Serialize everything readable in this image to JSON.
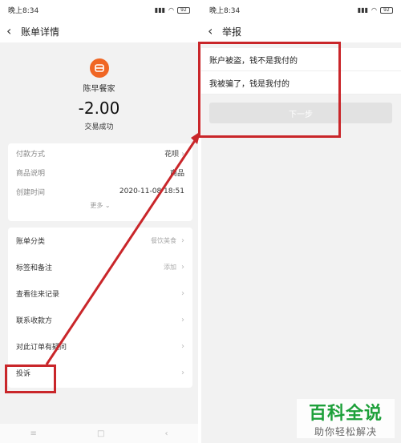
{
  "left": {
    "status": {
      "time": "晚上8:34",
      "battery": "92"
    },
    "nav_title": "账单详情",
    "merchant": {
      "name": "陈早餐家",
      "amount": "-2.00",
      "status": "交易成功"
    },
    "details": [
      {
        "key": "付款方式",
        "value": "花呗"
      },
      {
        "key": "商品说明",
        "value": "商品"
      },
      {
        "key": "创建时间",
        "value": "2020-11-08 18:51"
      }
    ],
    "more": "更多",
    "menu": [
      {
        "label": "账单分类",
        "value": "餐饮美食"
      },
      {
        "label": "标签和备注",
        "value": "添加"
      },
      {
        "label": "查看往来记录",
        "value": ""
      },
      {
        "label": "联系收款方",
        "value": ""
      },
      {
        "label": "对此订单有疑问",
        "value": ""
      },
      {
        "label": "投诉",
        "value": ""
      }
    ]
  },
  "right": {
    "status": {
      "time": "晚上8:34",
      "battery": "92"
    },
    "nav_title": "举报",
    "options": [
      "账户被盗，钱不是我付的",
      "我被骗了，钱是我付的"
    ],
    "next_button": "下一步"
  },
  "watermark": {
    "big": "百科全说",
    "small": "助你轻松解决"
  },
  "colors": {
    "highlight": "#c9262a",
    "merchant_logo": "#f06624",
    "watermark": "#1da03a"
  }
}
